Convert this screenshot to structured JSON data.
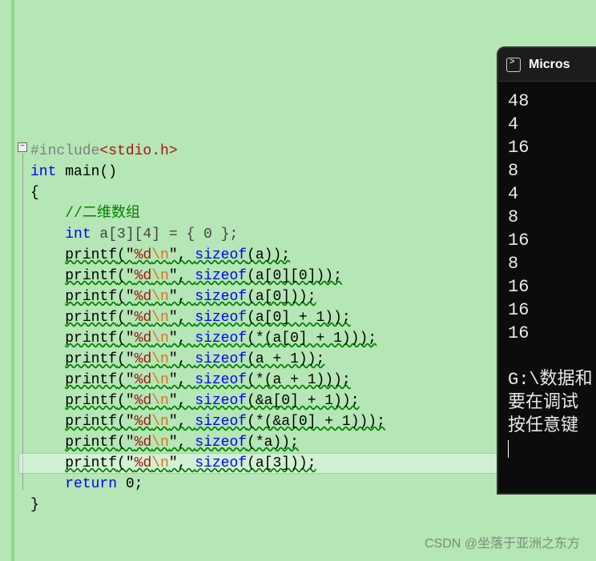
{
  "code": {
    "include_directive": "#include",
    "include_header": "<stdio.h>",
    "kw_int": "int",
    "fn_main": "main",
    "parens": "()",
    "open_brace": "{",
    "comment": "//二维数组",
    "decl_int": "int",
    "decl_rest": " a[3][4] = { 0 };",
    "printf": "printf",
    "fmt_open": "(\"",
    "fmt_pct": "%d",
    "fmt_esc": "\\n",
    "fmt_close": "\", ",
    "sizeof": "sizeof",
    "args": [
      "(a));",
      "(a[0][0]));",
      "(a[0]));",
      "(a[0] + 1));",
      "(*(a[0] + 1)));",
      "(a + 1));",
      "(*(a + 1)));",
      "(&a[0] + 1));",
      "(*(&a[0] + 1)));",
      "(*a));",
      "(a[3]));"
    ],
    "kw_return": "return",
    "zero": " 0;",
    "close_brace": "}",
    "fold": "−"
  },
  "console": {
    "title": "Micros",
    "output": [
      "48",
      "4",
      "16",
      "8",
      "4",
      "8",
      "16",
      "8",
      "16",
      "16",
      "16"
    ],
    "path": "G:\\数据和",
    "msg1": "要在调试",
    "msg2": "按任意键"
  },
  "watermark": "CSDN @坐落于亚洲之东方"
}
